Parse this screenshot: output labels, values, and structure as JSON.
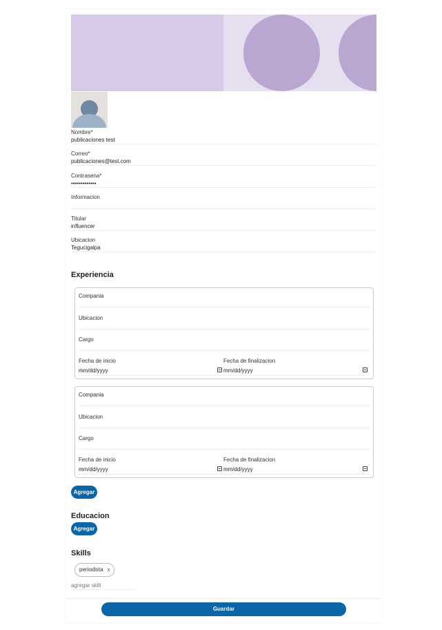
{
  "profile": {
    "fields": [
      {
        "label": "Nombre*",
        "value": "publicaciones test"
      },
      {
        "label": "Correo*",
        "value": "publicaciones@test.com"
      },
      {
        "label": "Contrasena*",
        "value": "•••••••••••••"
      },
      {
        "label": "Informacion",
        "value": ""
      },
      {
        "label": "Titular",
        "value": "influencer"
      },
      {
        "label": "Ubicacion",
        "value": "Tegucigalpa"
      }
    ]
  },
  "experience": {
    "title": "Experiencia",
    "entries": [
      {
        "company_label": "Compania",
        "location_label": "Ubicacion",
        "role_label": "Cargo",
        "start_label": "Fecha de inicio",
        "start_placeholder": "mm/dd/yyyy",
        "end_label": "Fecha de finalizacion",
        "end_placeholder": "mm/dd/yyyy"
      },
      {
        "company_label": "Compania",
        "location_label": "Ubicacion",
        "role_label": "Cargo",
        "start_label": "Fecha de inicio",
        "start_placeholder": "mm/dd/yyyy",
        "end_label": "Fecha de finalizacion",
        "end_placeholder": "mm/dd/yyyy"
      }
    ],
    "add_label": "Agregar"
  },
  "education": {
    "title": "Educacion",
    "add_label": "Agregar"
  },
  "skills": {
    "title": "Skills",
    "items": [
      "periodista"
    ],
    "remove_label": "x",
    "input_placeholder": "agregar skill"
  },
  "save_label": "Guardar",
  "colors": {
    "primary": "#0a66a8",
    "banner_dark": "#d6cae6",
    "banner_light": "#e6dff0",
    "banner_circle": "#b9a6d1"
  },
  "icons": [
    "calendar-icon",
    "avatar-placeholder-icon"
  ]
}
